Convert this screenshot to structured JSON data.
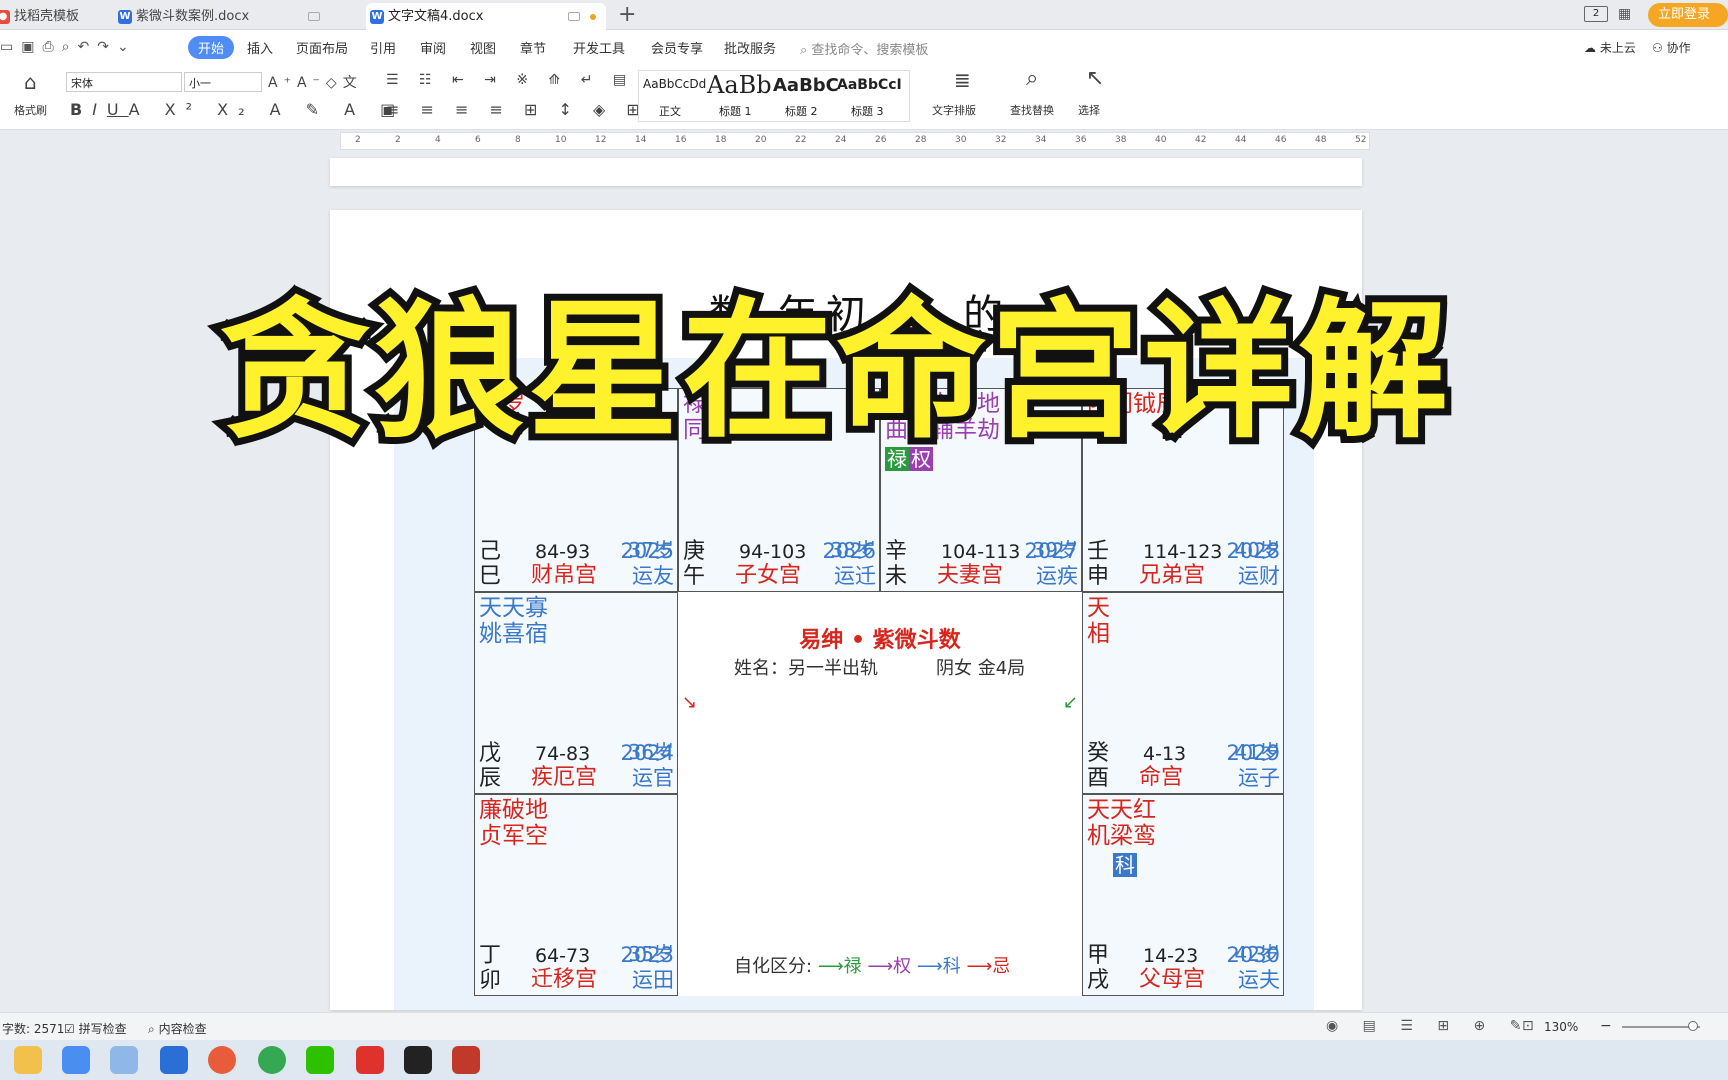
{
  "tabs": [
    {
      "label": "找稻壳模板",
      "icon_color": "#e74c3c"
    },
    {
      "label": "紫微斗数案例.docx",
      "icon_color": "#2f6fe0"
    },
    {
      "label": "文字文稿4.docx",
      "icon_color": "#2f6fe0"
    }
  ],
  "top_right": {
    "login": "立即登录",
    "window_count": "2"
  },
  "menu": [
    "开始",
    "插入",
    "页面布局",
    "引用",
    "审阅",
    "视图",
    "章节",
    "开发工具",
    "会员专享",
    "批改服务"
  ],
  "search_placeholder": "查找命令、搜索模板",
  "menu_right": {
    "cloud": "未上云",
    "collab": "协作"
  },
  "ribbon": {
    "format_painter": "格式刷",
    "font": "宋体",
    "size": "小一",
    "styles": [
      {
        "preview": "AaBbCcDd",
        "label": "正文"
      },
      {
        "preview": "AaBb",
        "label": "标题 1"
      },
      {
        "preview": "AaBbC",
        "label": "标题 2"
      },
      {
        "preview": "AaBbCcI",
        "label": "标题 3"
      }
    ],
    "layout": "文字排版",
    "find": "查找替换",
    "select": "选择"
  },
  "ruler": [
    "2",
    "2",
    "4",
    "6",
    "8",
    "10",
    "12",
    "14",
    "16",
    "18",
    "20",
    "22",
    "24",
    "26",
    "28",
    "30",
    "32",
    "34",
    "36",
    "38",
    "40",
    "42",
    "44",
    "46",
    "48",
    "52"
  ],
  "doc_title": "数 年初 子 的",
  "overlay": "贪狼星在命宫详解",
  "chart": {
    "center_title": "易绅 • 紫微斗数",
    "center_name": "姓名：另一半出轨",
    "center_type": "阴女 金4局",
    "legend_prefix": "自化区分:",
    "legend": [
      "禄",
      "权",
      "科",
      "忌"
    ],
    "cells": [
      {
        "stars": "府罗",
        "gz": "己巳",
        "range": "84-93",
        "name": "财帛宫",
        "age": "37岁",
        "year": "2025",
        "yun": "运友"
      },
      {
        "stars": "禄 同阴存星",
        "gz": "庚午",
        "range": "94-103",
        "name": "子女宫",
        "age": "38岁",
        "year": "2026",
        "yun": "运迁"
      },
      {
        "stars": "武贪左擎地 曲狼辅羊劫",
        "gz": "辛未",
        "range": "104-113",
        "name": "夫妻宫",
        "age": "39岁",
        "year": "2027",
        "yun": "运疾"
      },
      {
        "stars": "阳门钺辰",
        "gz": "壬申",
        "range": "114-123",
        "name": "兄弟宫",
        "age": "40岁",
        "year": "2028",
        "yun": "运财"
      },
      {
        "stars": "天天寡 姚喜宿",
        "gz": "戊辰",
        "range": "74-83",
        "name": "疾厄宫",
        "age": "36岁",
        "year": "2024",
        "yun": "运官"
      },
      {
        "stars": "天 相",
        "gz": "癸酉",
        "range": "4-13",
        "name": "命宫",
        "age": "41岁",
        "year": "2029",
        "yun": "运子"
      },
      {
        "stars": "廉破地 贞军空",
        "gz": "丁卯",
        "range": "64-73",
        "name": "迁移宫",
        "age": "35岁",
        "year": "2023",
        "yun": "运田"
      },
      {
        "stars": "天天红 机梁鸾",
        "gz": "甲戌",
        "range": "14-23",
        "name": "父母宫",
        "age": "42岁",
        "year": "2030",
        "yun": "运夫"
      }
    ],
    "badges": [
      "禄",
      "权",
      "科"
    ]
  },
  "status": {
    "words": "字数: 2571",
    "spell": "拼写检查",
    "content": "内容检查",
    "zoom": "130%"
  }
}
